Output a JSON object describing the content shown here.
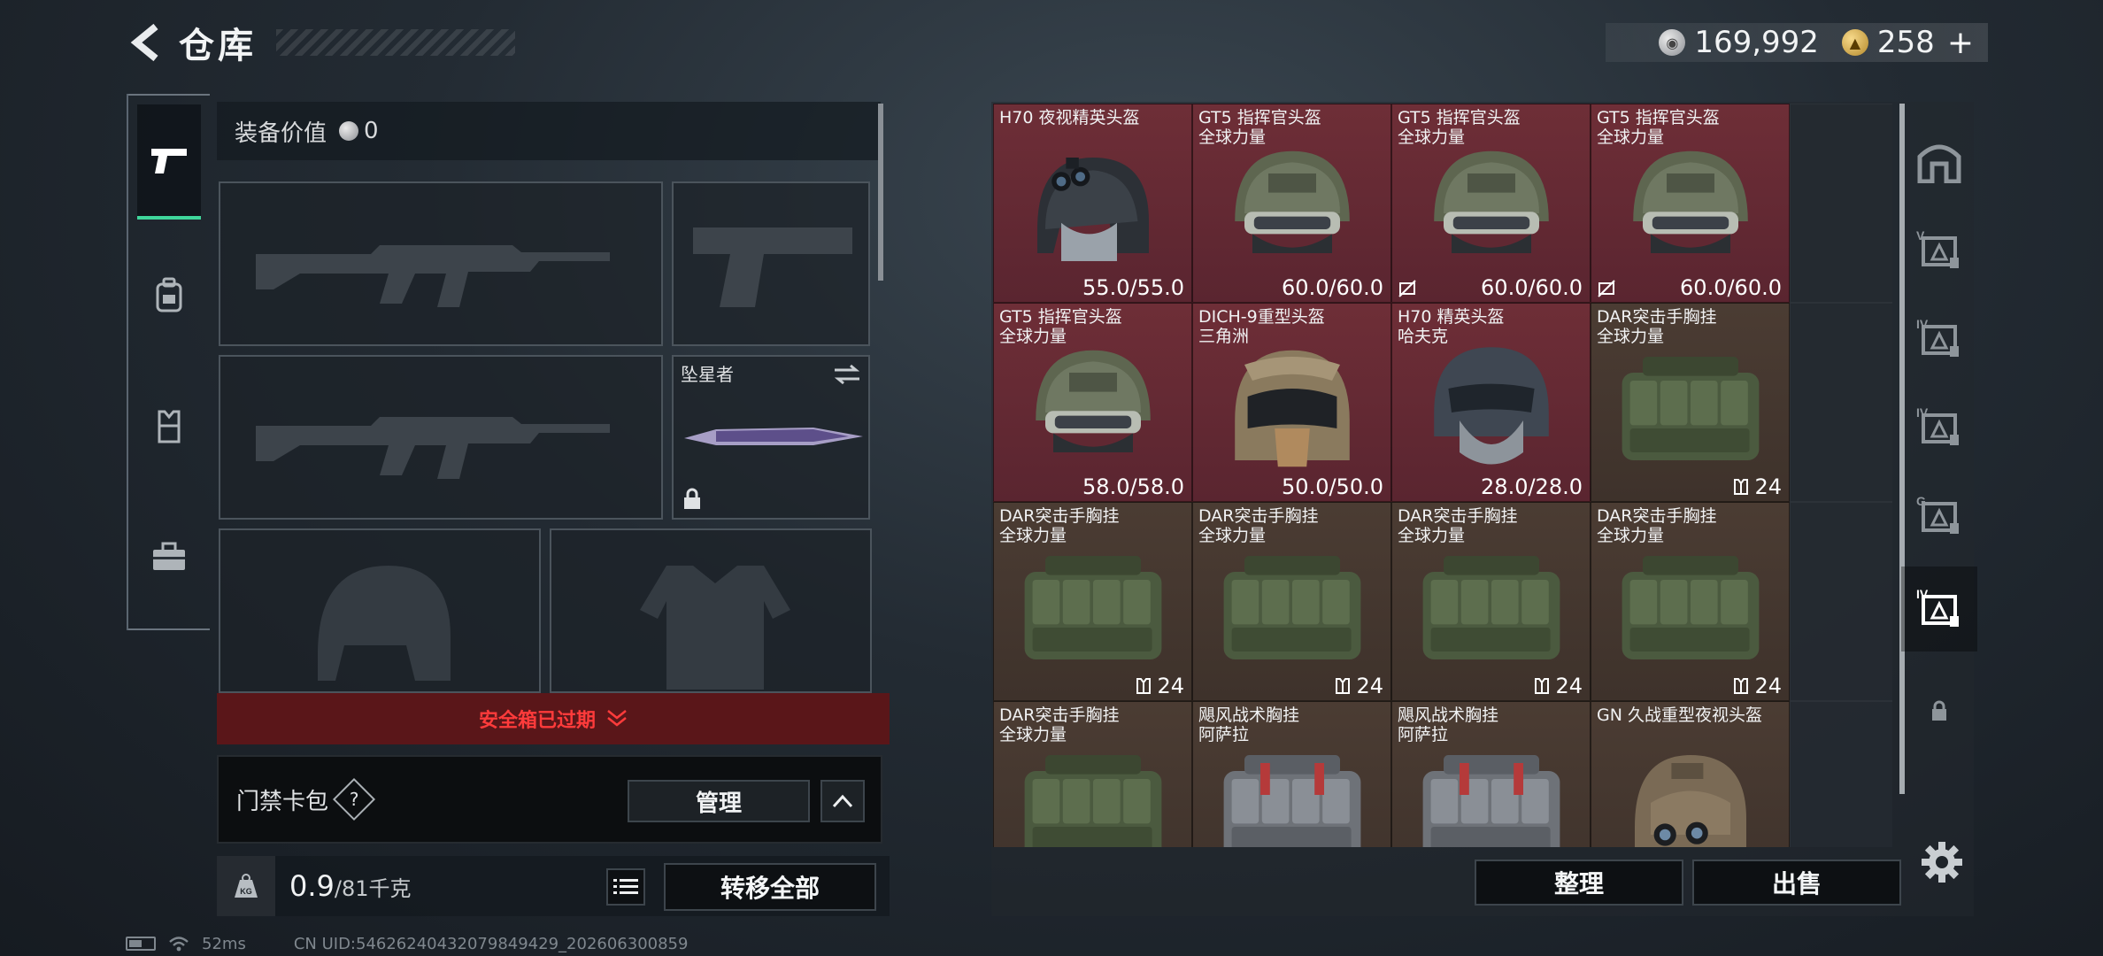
{
  "header": {
    "title": "仓库",
    "silver_amount": "169,992",
    "gold_amount": "258",
    "add_label": "+"
  },
  "left_tabs": [
    {
      "id": "weapons",
      "icon": "pistol-icon",
      "active": true
    },
    {
      "id": "backpack",
      "icon": "backpack-icon",
      "active": false
    },
    {
      "id": "chest-rig",
      "icon": "chest-rig-icon",
      "active": false
    },
    {
      "id": "toolbox",
      "icon": "toolbox-icon",
      "active": false
    }
  ],
  "loadout": {
    "value_label": "装备价值",
    "value_amount": "0",
    "melee_name": "坠星者",
    "safe_banner": "安全箱已过期",
    "card_bag_label": "门禁卡包",
    "help_label": "?",
    "manage_label": "管理",
    "weight_current": "0.9",
    "weight_max": "/81千克",
    "weight_icon_label": "KG",
    "transfer_all_label": "转移全部"
  },
  "inventory": {
    "items": [
      {
        "name": "H70 夜视精英头盔",
        "sub": "",
        "value": "55.0/55.0",
        "bg": "red",
        "type": "helmet-nv",
        "no_repair": false
      },
      {
        "name": "GT5 指挥官头盔",
        "sub": "全球力量",
        "value": "60.0/60.0",
        "bg": "red",
        "type": "helmet-gt5",
        "no_repair": false
      },
      {
        "name": "GT5 指挥官头盔",
        "sub": "全球力量",
        "value": "60.0/60.0",
        "bg": "red",
        "type": "helmet-gt5",
        "no_repair": true
      },
      {
        "name": "GT5 指挥官头盔",
        "sub": "全球力量",
        "value": "60.0/60.0",
        "bg": "red",
        "type": "helmet-gt5",
        "no_repair": true
      },
      {
        "name": "GT5 指挥官头盔",
        "sub": "全球力量",
        "value": "58.0/58.0",
        "bg": "red",
        "type": "helmet-gt5",
        "no_repair": false
      },
      {
        "name": "DICH-9重型头盔",
        "sub": "三角洲",
        "value": "50.0/50.0",
        "bg": "red",
        "type": "helmet-dich",
        "no_repair": false
      },
      {
        "name": "H70 精英头盔",
        "sub": "哈夫克",
        "value": "28.0/28.0",
        "bg": "red",
        "type": "helmet-h70",
        "no_repair": false
      },
      {
        "name": "DAR突击手胸挂",
        "sub": "全球力量",
        "value": "24",
        "bg": "brown",
        "type": "rig-green",
        "no_repair": false
      },
      {
        "name": "DAR突击手胸挂",
        "sub": "全球力量",
        "value": "24",
        "bg": "brown",
        "type": "rig-green",
        "no_repair": false
      },
      {
        "name": "DAR突击手胸挂",
        "sub": "全球力量",
        "value": "24",
        "bg": "brown",
        "type": "rig-green",
        "no_repair": false
      },
      {
        "name": "DAR突击手胸挂",
        "sub": "全球力量",
        "value": "24",
        "bg": "brown",
        "type": "rig-green",
        "no_repair": false
      },
      {
        "name": "DAR突击手胸挂",
        "sub": "全球力量",
        "value": "24",
        "bg": "brown",
        "type": "rig-green",
        "no_repair": false
      },
      {
        "name": "DAR突击手胸挂",
        "sub": "全球力量",
        "value": "",
        "bg": "brown",
        "type": "rig-green",
        "no_repair": false
      },
      {
        "name": "飓风战术胸挂",
        "sub": "阿萨拉",
        "value": "",
        "bg": "brown",
        "type": "rig-grey",
        "no_repair": false
      },
      {
        "name": "飓风战术胸挂",
        "sub": "阿萨拉",
        "value": "",
        "bg": "brown",
        "type": "rig-grey",
        "no_repair": false
      },
      {
        "name": "GN 久战重型夜视头盔",
        "sub": "",
        "value": "",
        "bg": "brown",
        "type": "helmet-gn",
        "no_repair": false
      }
    ],
    "sort_label": "整理",
    "sell_label": "出售"
  },
  "right_rail": [
    {
      "icon": "vault-icon",
      "active": false
    },
    {
      "icon": "tier-v-case-icon",
      "label": "V",
      "active": false
    },
    {
      "icon": "tier-iv-case-icon",
      "label": "IV",
      "active": false
    },
    {
      "icon": "tier-iv-case-icon",
      "label": "IV",
      "active": false
    },
    {
      "icon": "tier-g-case-icon",
      "label": "G",
      "active": false
    },
    {
      "icon": "tier-iv-selected-case-icon",
      "label": "IV",
      "active": true
    },
    {
      "icon": "lock-icon",
      "active": false
    }
  ],
  "status": {
    "ping": "52ms",
    "uid": "CN UID:5462624043207984942​9_202606300859"
  }
}
